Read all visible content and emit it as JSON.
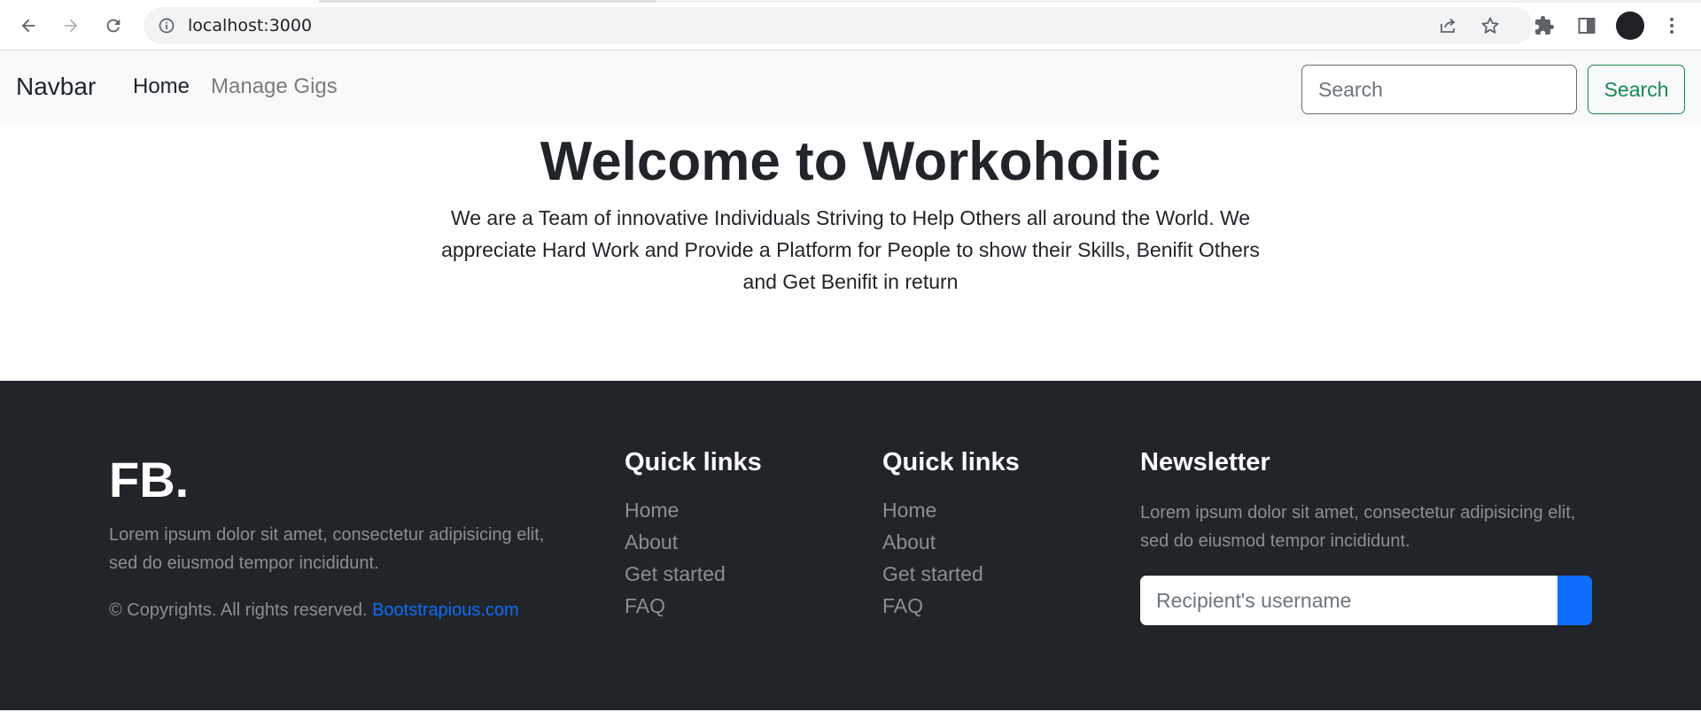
{
  "browser": {
    "url": "localhost:3000",
    "back_icon": "arrow-left-icon",
    "forward_icon": "arrow-right-icon",
    "reload_icon": "reload-icon",
    "info_icon": "info-icon",
    "share_icon": "share-icon",
    "bookmark_icon": "star-icon",
    "extensions_icon": "puzzle-icon",
    "sidepanel_icon": "side-panel-icon",
    "menu_icon": "kebab-menu-icon"
  },
  "navbar": {
    "brand": "Navbar",
    "links": [
      {
        "label": "Home",
        "active": true
      },
      {
        "label": "Manage Gigs",
        "active": false
      }
    ],
    "search_placeholder": "Search",
    "search_button": "Search",
    "search_color": "#198754"
  },
  "hero": {
    "title": "Welcome to Workoholic",
    "text": "We are a Team of innovative Individuals Striving to Help Others all around the World. We appreciate Hard Work and Provide a Platform for People to show their Skills, Benifit Others and Get Benifit in return"
  },
  "footer": {
    "logo": "FB.",
    "description": "Lorem ipsum dolor sit amet, consectetur adipisicing elit, sed do eiusmod tempor incididunt.",
    "copyright": "© Copyrights. All rights reserved.",
    "copyright_link": "Bootstrapious.com",
    "columns": [
      {
        "heading": "Quick links",
        "links": [
          "Home",
          "About",
          "Get started",
          "FAQ"
        ]
      },
      {
        "heading": "Quick links",
        "links": [
          "Home",
          "About",
          "Get started",
          "FAQ"
        ]
      }
    ],
    "newsletter": {
      "heading": "Newsletter",
      "description": "Lorem ipsum dolor sit amet, consectetur adipisicing elit, sed do eiusmod tempor incididunt.",
      "input_placeholder": "Recipient's username",
      "button_color": "#0d6efd"
    },
    "background": "#212529"
  }
}
